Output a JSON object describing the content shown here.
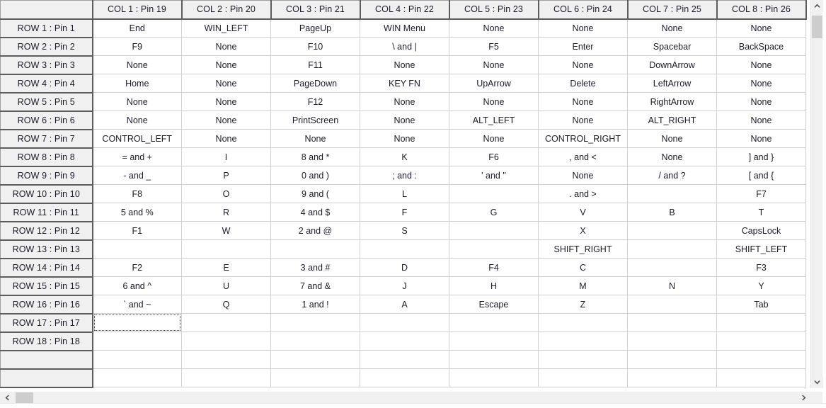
{
  "grid": {
    "corner_label": "",
    "column_headers": [
      "COL 1 : Pin 19",
      "COL 2 : Pin 20",
      "COL 3 : Pin 21",
      "COL 4 : Pin 22",
      "COL 5 : Pin 23",
      "COL 6 : Pin 24",
      "COL 7 : Pin 25",
      "COL 8 : Pin 26"
    ],
    "row_headers": [
      "ROW 1 : Pin 1",
      "ROW 2 : Pin 2",
      "ROW 3 : Pin 3",
      "ROW 4 : Pin 4",
      "ROW 5 : Pin 5",
      "ROW 6 : Pin 6",
      "ROW 7 : Pin 7",
      "ROW 8 : Pin 8",
      "ROW 9 : Pin 9",
      "ROW 10 : Pin 10",
      "ROW 11 : Pin 11",
      "ROW 12 : Pin 12",
      "ROW 13 : Pin 13",
      "ROW 14 : Pin 14",
      "ROW 15 : Pin 15",
      "ROW 16 : Pin 16",
      "ROW 17 : Pin 17",
      "ROW 18 : Pin 18",
      "",
      ""
    ],
    "rows": [
      [
        "End",
        "WIN_LEFT",
        "PageUp",
        "WIN Menu",
        "None",
        "None",
        "None",
        "None"
      ],
      [
        "F9",
        "None",
        "F10",
        "\\ and |",
        "F5",
        "Enter",
        "Spacebar",
        "BackSpace"
      ],
      [
        "None",
        "None",
        "F11",
        "None",
        "None",
        "None",
        "DownArrow",
        "None"
      ],
      [
        "Home",
        "None",
        "PageDown",
        "KEY FN",
        "UpArrow",
        "Delete",
        "LeftArrow",
        "None"
      ],
      [
        "None",
        "None",
        "F12",
        "None",
        "None",
        "None",
        "RightArrow",
        "None"
      ],
      [
        "None",
        "None",
        "PrintScreen",
        "None",
        "ALT_LEFT",
        "None",
        "ALT_RIGHT",
        "None"
      ],
      [
        "CONTROL_LEFT",
        "None",
        "None",
        "None",
        "None",
        "CONTROL_RIGHT",
        "None",
        "None"
      ],
      [
        "= and +",
        "I",
        "8 and *",
        "K",
        "F6",
        ", and <",
        "None",
        "] and }"
      ],
      [
        "- and _",
        "P",
        "0 and )",
        "; and :",
        "' and \"",
        "None",
        "/ and ?",
        "[ and {"
      ],
      [
        "F8",
        "O",
        "9 and (",
        "L",
        "",
        ". and >",
        "",
        "F7"
      ],
      [
        "5 and %",
        "R",
        "4 and $",
        "F",
        "G",
        "V",
        "B",
        "T"
      ],
      [
        "F1",
        "W",
        "2 and @",
        "S",
        "",
        "X",
        "",
        "CapsLock"
      ],
      [
        "",
        "",
        "",
        "",
        "",
        "SHIFT_RIGHT",
        "",
        "SHIFT_LEFT"
      ],
      [
        "F2",
        "E",
        "3 and #",
        "D",
        "F4",
        "C",
        "",
        "F3"
      ],
      [
        "6 and ^",
        "U",
        "7 and &",
        "J",
        "H",
        "M",
        "N",
        "Y"
      ],
      [
        "` and ~",
        "Q",
        "1 and !",
        "A",
        "Escape",
        "Z",
        "",
        "Tab"
      ],
      [
        "",
        "",
        "",
        "",
        "",
        "",
        "",
        ""
      ],
      [
        "",
        "",
        "",
        "",
        "",
        "",
        "",
        ""
      ],
      [
        "",
        "",
        "",
        "",
        "",
        "",
        "",
        ""
      ],
      [
        "",
        "",
        "",
        "",
        "",
        "",
        "",
        ""
      ]
    ],
    "focused_cell": {
      "row": 16,
      "col": 0
    }
  },
  "scrollbars": {
    "vertical": {
      "up_arrow": "chevron-up",
      "down_arrow": "chevron-down"
    },
    "horizontal": {
      "left_arrow": "chevron-left",
      "right_arrow": "chevron-right"
    }
  },
  "colors": {
    "header_text": "#ff2222",
    "header_bg": "#f0f0f0",
    "cell_text": "#1b1b2a",
    "grid_line": "#d0d0d0",
    "header_border": "#5c5c5c",
    "thumb": "#cdcdcd"
  }
}
